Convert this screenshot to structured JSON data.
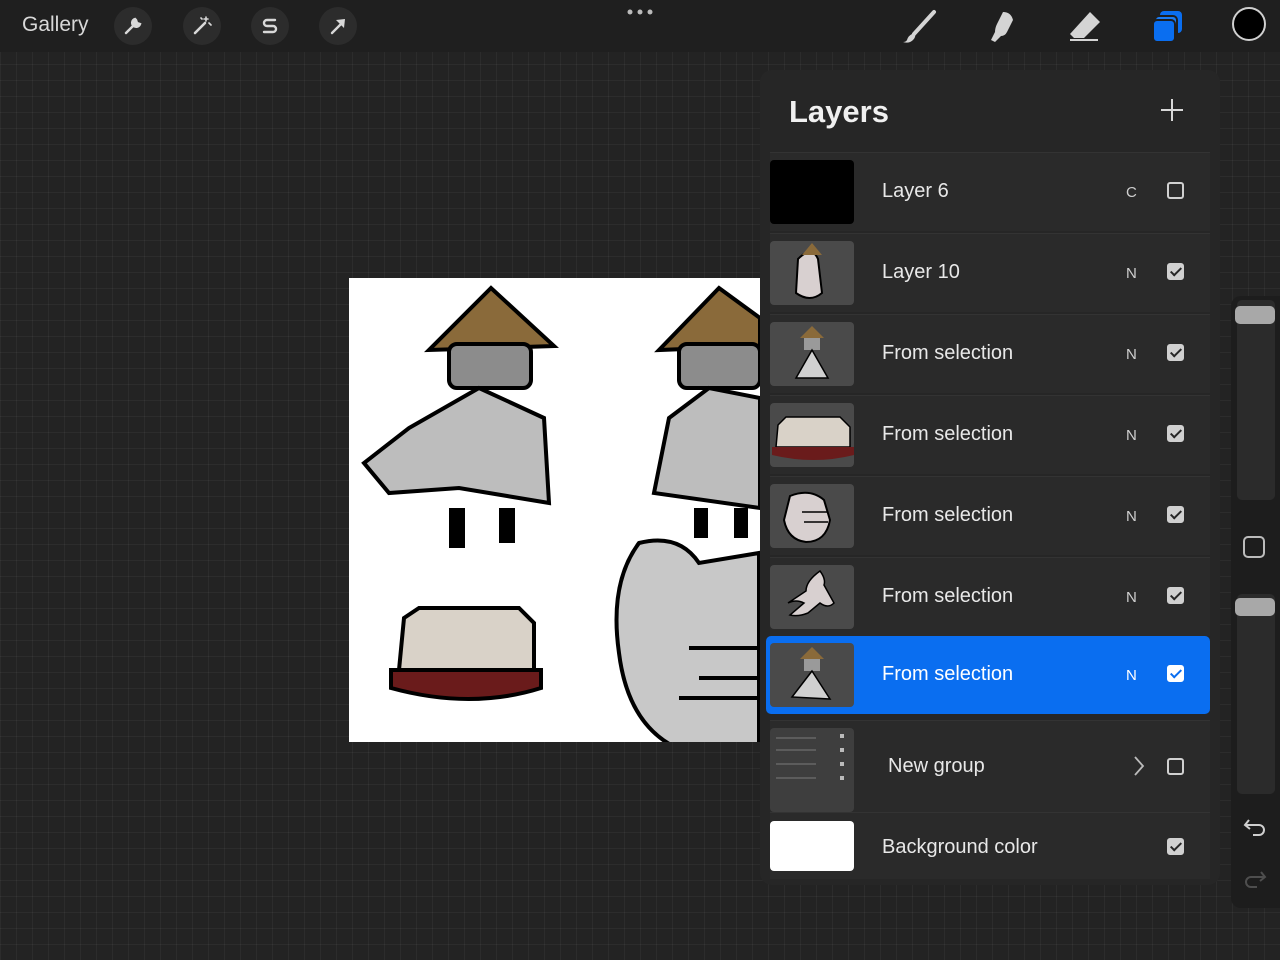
{
  "topbar": {
    "gallery_label": "Gallery",
    "left_tools": [
      "wrench-icon",
      "magic-wand-icon",
      "selection-s-icon",
      "transform-arrow-icon"
    ],
    "right_tools": [
      "brush-icon",
      "smudge-icon",
      "eraser-icon",
      "layers-icon"
    ],
    "active_tool": "layers-icon",
    "current_color": "#000000"
  },
  "layers_panel": {
    "title": "Layers",
    "add_button": "plus-icon",
    "layers": [
      {
        "name": "Layer 6",
        "blend": "C",
        "visible": false,
        "selected": false
      },
      {
        "name": "Layer 10",
        "blend": "N",
        "visible": true,
        "selected": false
      },
      {
        "name": "From selection",
        "blend": "N",
        "visible": true,
        "selected": false
      },
      {
        "name": "From selection",
        "blend": "N",
        "visible": true,
        "selected": false
      },
      {
        "name": "From selection",
        "blend": "N",
        "visible": true,
        "selected": false
      },
      {
        "name": "From selection",
        "blend": "N",
        "visible": true,
        "selected": false
      },
      {
        "name": "From selection",
        "blend": "N",
        "visible": true,
        "selected": true
      },
      {
        "name": "New group",
        "blend": "",
        "visible": false,
        "selected": false,
        "is_group": true
      },
      {
        "name": "Background color",
        "blend": "",
        "visible": true,
        "selected": false
      }
    ]
  },
  "colors": {
    "accent": "#0a6ef0",
    "panel_bg": "#262626",
    "canvas_bg": "#ffffff"
  }
}
